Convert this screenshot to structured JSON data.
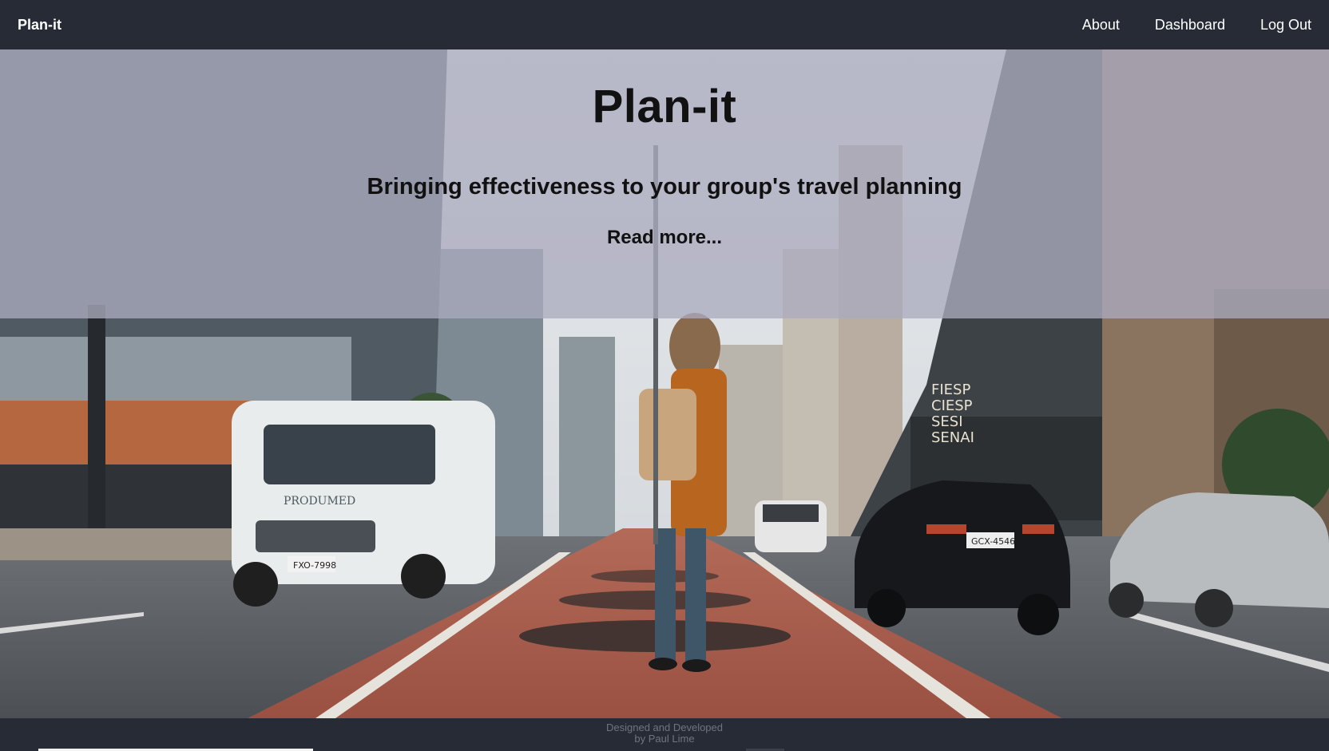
{
  "navbar": {
    "brand": "Plan-it",
    "links": [
      {
        "label": "About"
      },
      {
        "label": "Dashboard"
      },
      {
        "label": "Log Out"
      }
    ]
  },
  "hero": {
    "title": "Plan-it",
    "subtitle": "Bringing effectiveness to your group's travel planning",
    "read_more": "Read more...",
    "image": {
      "signage": [
        "FIESP",
        "CIESP",
        "SESI",
        "SENAI"
      ],
      "van_brand": "PRODUMED",
      "van_plate": "FXO-7998",
      "car_plate": "GCX-4546"
    }
  },
  "footer": {
    "line1": "Designed and Developed",
    "line2": "by Paul Lime"
  },
  "colors": {
    "navbar_bg": "#272b36",
    "overlay": "rgba(170,170,190,0.78)",
    "bike_lane": "#a85a4c"
  }
}
